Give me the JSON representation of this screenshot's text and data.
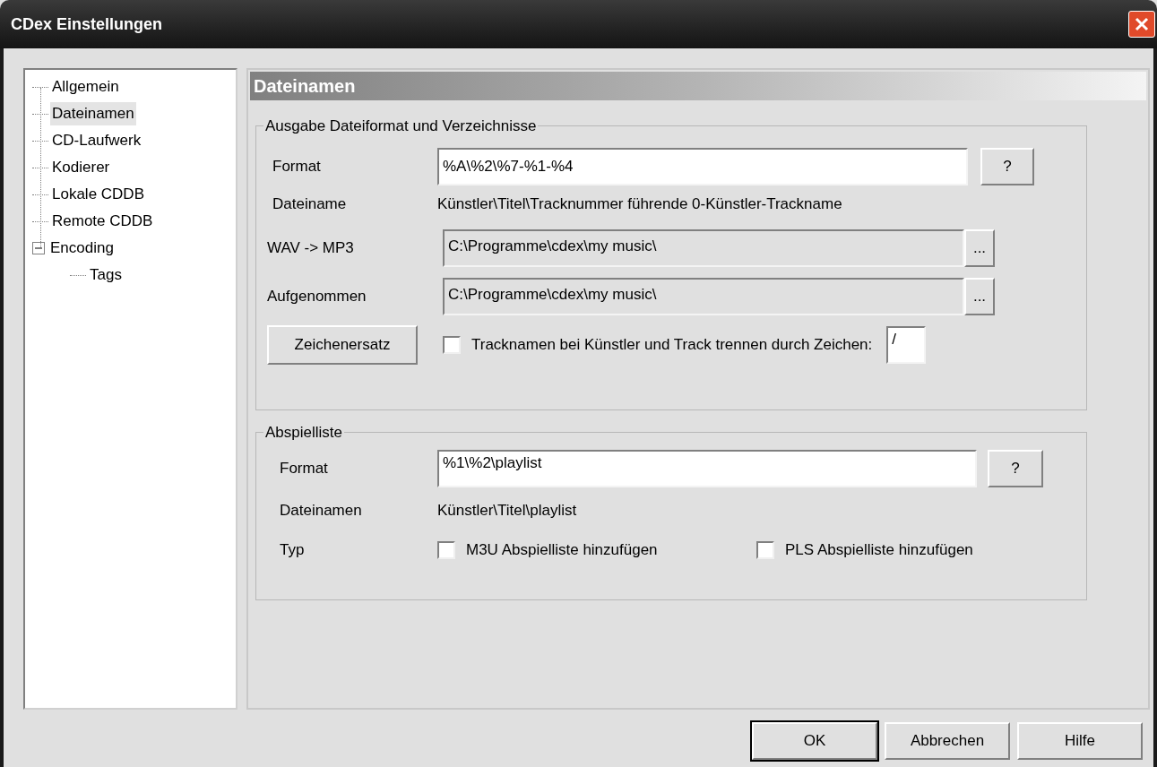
{
  "window": {
    "title": "CDex Einstellungen"
  },
  "sidebar": {
    "items": [
      {
        "label": "Allgemein",
        "selected": false
      },
      {
        "label": "Dateinamen",
        "selected": true
      },
      {
        "label": "CD-Laufwerk",
        "selected": false
      },
      {
        "label": "Kodierer",
        "selected": false
      },
      {
        "label": "Lokale CDDB",
        "selected": false
      },
      {
        "label": "Remote CDDB",
        "selected": false
      },
      {
        "label": "Encoding",
        "selected": false,
        "expanded": true,
        "children": [
          {
            "label": "Tags",
            "selected": false
          }
        ]
      }
    ]
  },
  "panel": {
    "title": "Dateinamen",
    "output": {
      "legend": "Ausgabe Dateiformat und Verzeichnisse",
      "format": {
        "label": "Format",
        "value": "%A\\%2\\%7-%1-%4",
        "help": "?"
      },
      "filename": {
        "label": "Dateiname",
        "value": "Künstler\\Titel\\Tracknummer führende 0-Künstler-Trackname"
      },
      "paths": [
        {
          "label": "WAV -> MP3",
          "value": "C:\\Programme\\cdex\\my music\\",
          "browse": "..."
        },
        {
          "label": "Aufgenommen",
          "value": "C:\\Programme\\cdex\\my music\\",
          "browse": "..."
        }
      ],
      "replace_button": "Zeichenersatz",
      "split": {
        "label": "Tracknamen bei Künstler und Track trennen durch Zeichen:",
        "checked": false,
        "char": "/"
      }
    },
    "playlist": {
      "legend": "Abspielliste",
      "format": {
        "label": "Format",
        "value": "%1\\%2\\playlist",
        "help": "?"
      },
      "filename": {
        "label": "Dateinamen",
        "value": "Künstler\\Titel\\playlist"
      },
      "type_label": "Typ",
      "options": [
        {
          "label": "M3U Abspielliste hinzufügen",
          "checked": false
        },
        {
          "label": "PLS Abspielliste hinzufügen",
          "checked": false
        }
      ]
    }
  },
  "buttons": [
    {
      "label": "OK",
      "default": true
    },
    {
      "label": "Abbrechen",
      "default": false
    },
    {
      "label": "Hilfe",
      "default": false
    }
  ]
}
